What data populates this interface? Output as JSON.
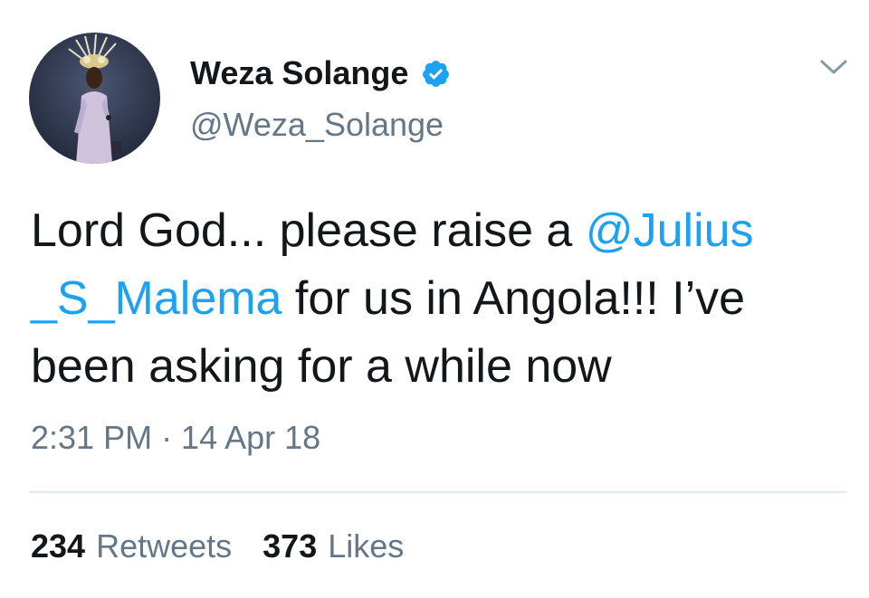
{
  "tweet": {
    "display_name": "Weza Solange",
    "handle": "@Weza_Solange",
    "verified_icon": "verified-badge-icon",
    "menu_icon": "chevron-down-icon",
    "body": {
      "part1": "Lord God... please raise a ",
      "mention_line1": "@Julius",
      "mention_line2": "_S_Malema",
      "part2": " for us in Angola!!! I’ve been asking for a while now"
    },
    "timestamp": "2:31 PM · 14 Apr 18",
    "stats": {
      "retweets_count": "234",
      "retweets_label": "Retweets",
      "likes_count": "373",
      "likes_label": "Likes"
    }
  },
  "colors": {
    "accent": "#1da1f2",
    "text": "#14171a",
    "secondary": "#657786",
    "divider": "#e1e8ed"
  }
}
